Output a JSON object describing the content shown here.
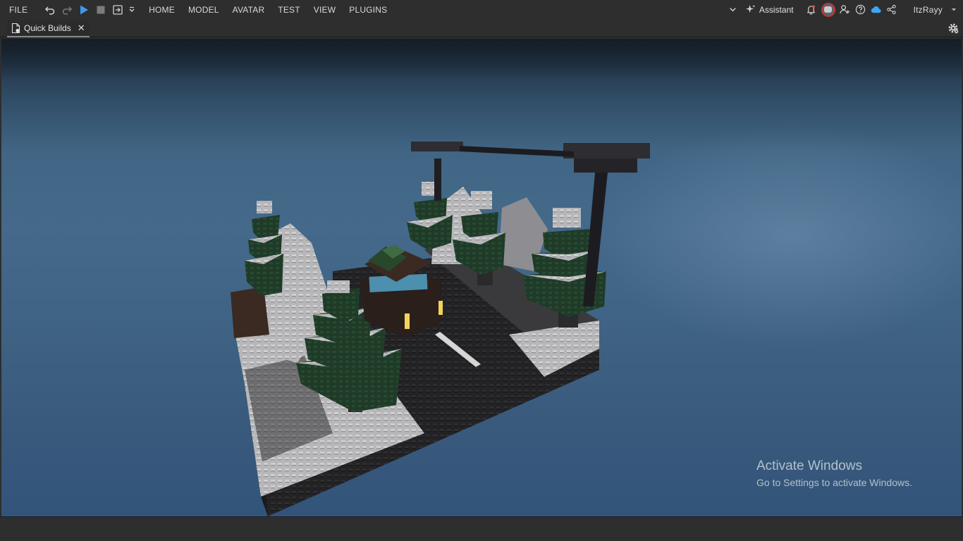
{
  "toolbar": {
    "file_label": "FILE",
    "menus": [
      "HOME",
      "MODEL",
      "AVATAR",
      "TEST",
      "VIEW",
      "PLUGINS"
    ],
    "icons": [
      "undo-icon",
      "redo-icon",
      "play-icon",
      "stop-icon",
      "exit-icon",
      "caret-down-icon"
    ],
    "play_color": "#3a9bf0"
  },
  "right_tools": {
    "assistant_label": "Assistant",
    "username": "ItzRayy",
    "icons": [
      "notification-bell-icon",
      "user-add-icon",
      "help-icon",
      "cloud-icon",
      "share-icon"
    ]
  },
  "tabs": [
    {
      "label": "Quick Builds",
      "icon": "document-icon",
      "active": true
    }
  ],
  "watermark": {
    "title": "Activate Windows",
    "subtitle": "Go to Settings to activate Windows."
  },
  "colors": {
    "chrome_bg": "#2e2e2e",
    "sky_top": "#1c2a38",
    "sky_mid": "#44698a",
    "sky_bottom": "#33547a",
    "window_glow": "#f2d45a"
  }
}
